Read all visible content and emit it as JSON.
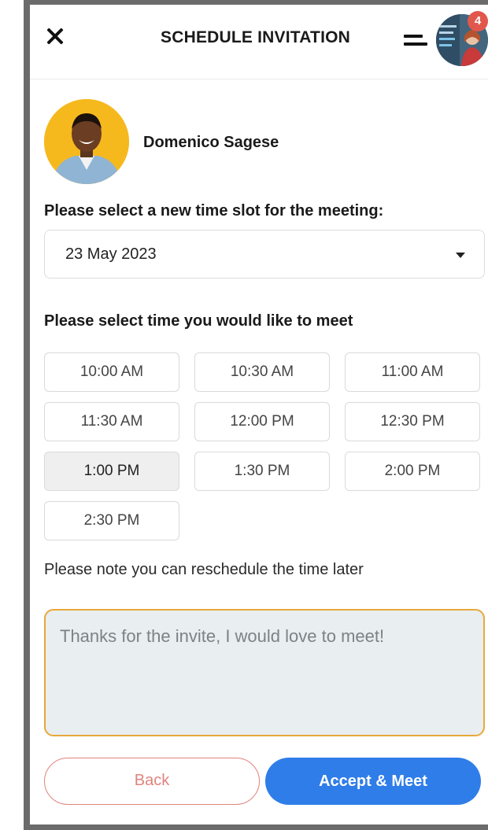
{
  "header": {
    "title": "SCHEDULE INVITATION",
    "close_icon": "close-icon",
    "menu_icon": "menu-icon",
    "notification_count": "4"
  },
  "profile": {
    "name": "Domenico Sagese"
  },
  "date_section": {
    "label": "Please select a new time slot for the meeting:",
    "selected_date": "23 May 2023"
  },
  "time_section": {
    "label": "Please select time you would like to meet",
    "slots": [
      "10:00 AM",
      "10:30 AM",
      "11:00 AM",
      "11:30 AM",
      "12:00 PM",
      "12:30 PM",
      "1:00 PM",
      "1:30 PM",
      "2:00 PM",
      "2:30 PM"
    ],
    "selected_slot": "1:00 PM"
  },
  "note": "Please note you can reschedule the time later",
  "message": {
    "placeholder": "Thanks for the invite, I would love to meet!"
  },
  "actions": {
    "back_label": "Back",
    "accept_label": "Accept & Meet"
  },
  "colors": {
    "accent_blue": "#2f7de9",
    "back_red": "#e0847d",
    "message_border": "#e8a83a",
    "badge_red": "#e2574c"
  }
}
